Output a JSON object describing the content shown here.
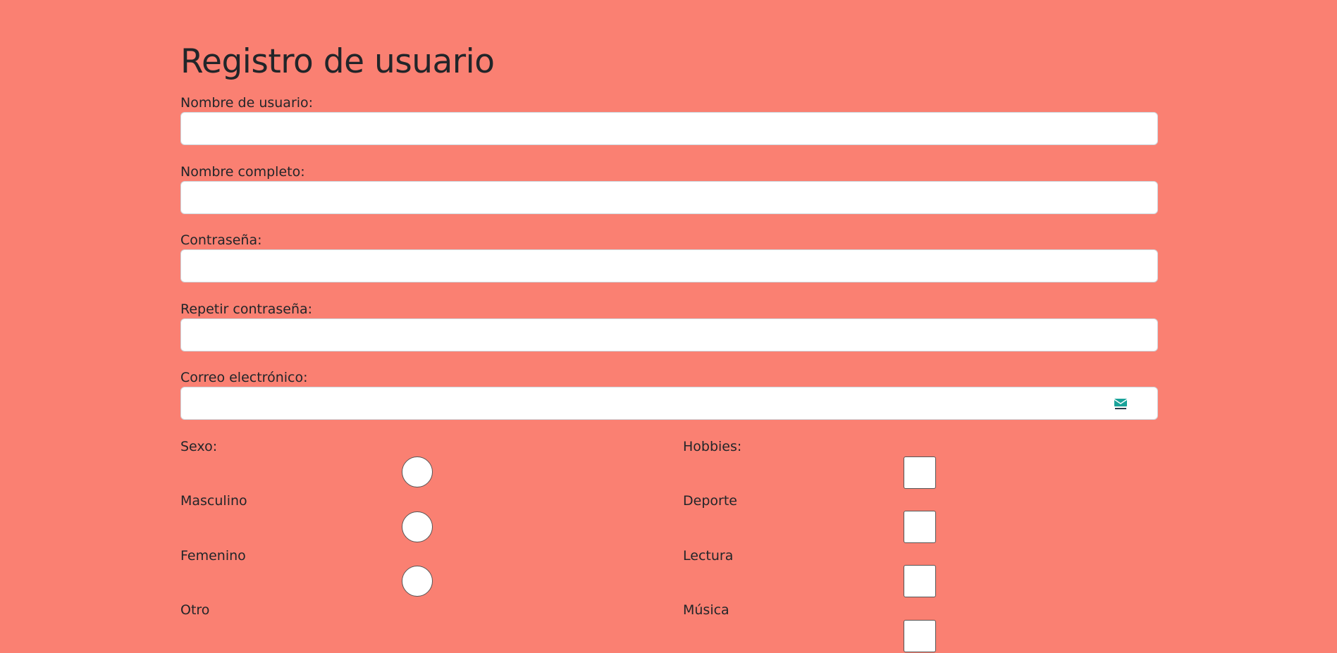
{
  "form": {
    "title": "Registro de usuario",
    "fields": {
      "username": {
        "label": "Nombre de usuario:",
        "value": ""
      },
      "fullname": {
        "label": "Nombre completo:",
        "value": ""
      },
      "password": {
        "label": "Contraseña:",
        "value": ""
      },
      "password_repeat": {
        "label": "Repetir contraseña:",
        "value": ""
      },
      "email": {
        "label": "Correo electrónico:",
        "value": "",
        "extension_icon": "mail-extension-icon"
      }
    },
    "sex": {
      "label": "Sexo:",
      "options": [
        "Masculino",
        "Femenino",
        "Otro"
      ]
    },
    "hobbies": {
      "label": "Hobbies:",
      "options": [
        "Deporte",
        "Lectura",
        "Música"
      ]
    }
  },
  "colors": {
    "background": "#fa8072",
    "text": "#212529",
    "input_bg": "#ffffff",
    "icon_accent": "#1aa39a"
  }
}
